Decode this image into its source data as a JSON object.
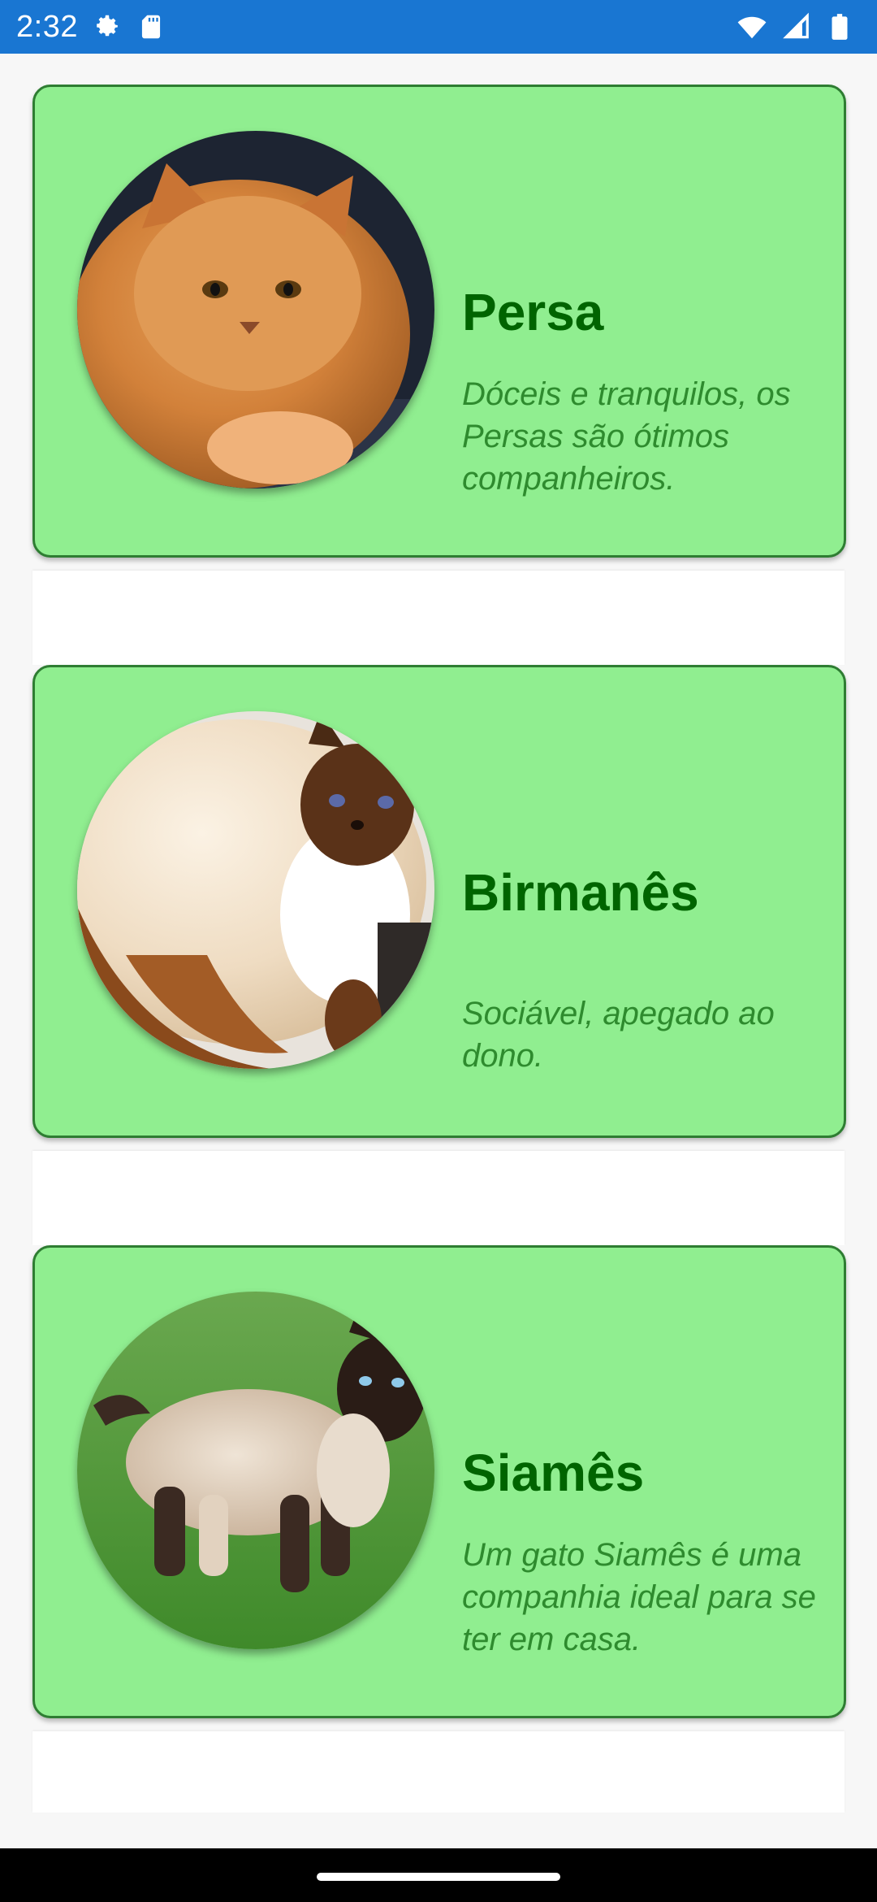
{
  "status_bar": {
    "time": "2:32",
    "icons": [
      "settings-icon",
      "sd-card-icon",
      "wifi-icon",
      "cell-signal-icon",
      "battery-icon"
    ],
    "background_color": "#1976d2"
  },
  "cats": [
    {
      "name": "Persa",
      "description": "Dóceis e tranquilos, os Persas são ótimos companheiros.",
      "photo": "persian-cat-photo"
    },
    {
      "name": "Birmanês",
      "description": "Sociável, apegado ao dono.",
      "photo": "birman-cat-photo"
    },
    {
      "name": "Siamês",
      "description": "Um gato Siamês é uma companhia ideal para se ter em casa.",
      "photo": "siamese-cat-photo"
    }
  ],
  "colors": {
    "card_background": "#90ee90",
    "card_border": "#2e7d32",
    "title": "#006400",
    "description": "#2e8b2e"
  }
}
